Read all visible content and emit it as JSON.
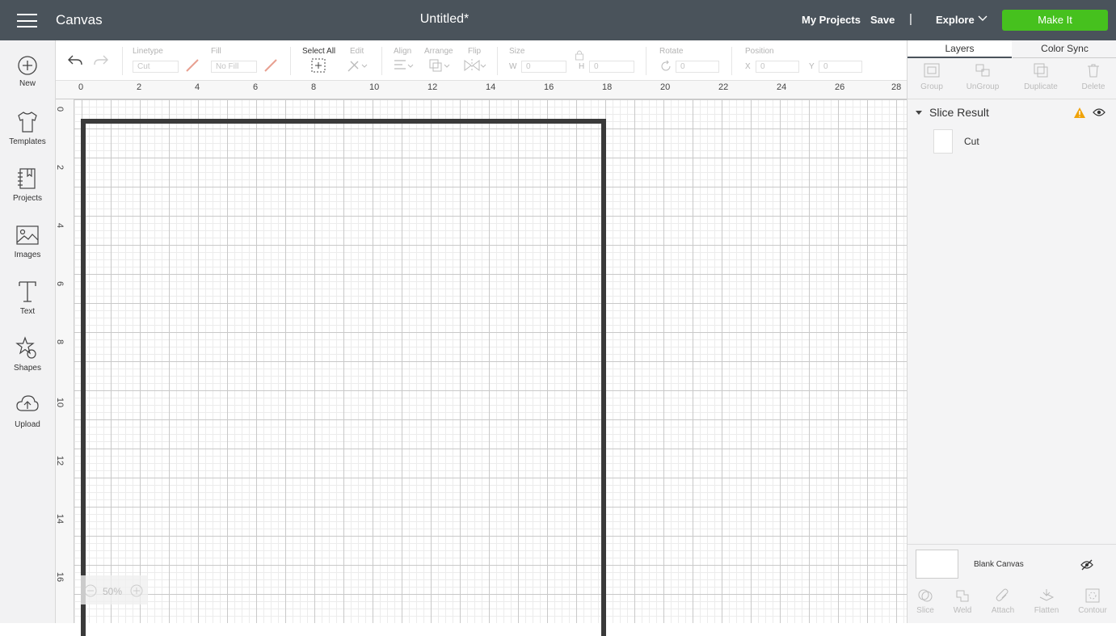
{
  "header": {
    "app_title": "Canvas",
    "doc_title": "Untitled*",
    "my_projects": "My Projects",
    "save": "Save",
    "separator": "|",
    "explore": "Explore",
    "make_it": "Make It"
  },
  "sidebar": {
    "items": [
      {
        "label": "New",
        "icon": "plus-circle-icon"
      },
      {
        "label": "Templates",
        "icon": "tshirt-icon"
      },
      {
        "label": "Projects",
        "icon": "projects-icon"
      },
      {
        "label": "Images",
        "icon": "image-icon"
      },
      {
        "label": "Text",
        "icon": "text-icon"
      },
      {
        "label": "Shapes",
        "icon": "shapes-icon"
      },
      {
        "label": "Upload",
        "icon": "upload-icon"
      }
    ]
  },
  "toolbar": {
    "linetype_label": "Linetype",
    "linetype_value": "Cut",
    "fill_label": "Fill",
    "fill_value": "No Fill",
    "select_all": "Select All",
    "edit": "Edit",
    "align": "Align",
    "arrange": "Arrange",
    "flip": "Flip",
    "size": "Size",
    "w_label": "W",
    "w_value": "0",
    "h_label": "H",
    "h_value": "0",
    "rotate": "Rotate",
    "rotate_value": "0",
    "position": "Position",
    "x_label": "X",
    "x_value": "0",
    "y_label": "Y",
    "y_value": "0"
  },
  "rulers": {
    "top": [
      "0",
      "2",
      "4",
      "6",
      "8",
      "10",
      "12",
      "14",
      "16",
      "18",
      "20",
      "22",
      "24",
      "26",
      "28"
    ],
    "left": [
      "0",
      "2",
      "4",
      "6",
      "8",
      "10",
      "12",
      "14",
      "16"
    ]
  },
  "zoom": {
    "value": "50%"
  },
  "right_panel": {
    "tabs": [
      "Layers",
      "Color Sync"
    ],
    "tools": [
      "Group",
      "UnGroup",
      "Duplicate",
      "Delete"
    ],
    "layer_group": "Slice Result",
    "layer_item": "Cut",
    "blank_canvas": "Blank Canvas",
    "bottom_tools": [
      "Slice",
      "Weld",
      "Attach",
      "Flatten",
      "Contour"
    ]
  },
  "colors": {
    "header_bg": "#4a535b",
    "make_it_green": "#46c11e",
    "warning": "#f0a30a"
  }
}
